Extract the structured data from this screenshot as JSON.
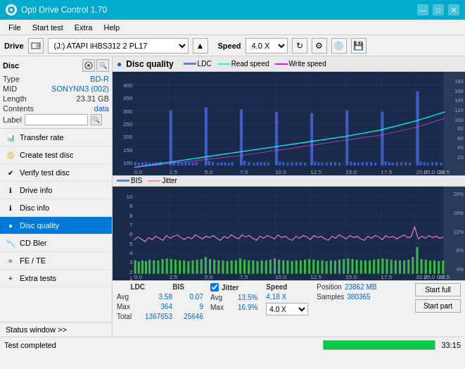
{
  "app": {
    "title": "Opti Drive Control 1.70",
    "min": "—",
    "max": "□",
    "close": "✕"
  },
  "menubar": {
    "items": [
      "File",
      "Start test",
      "Extra",
      "Help"
    ]
  },
  "toolbar": {
    "drive_label": "Drive",
    "drive_value": "(J:) ATAPI iHBS312  2 PL17",
    "speed_label": "Speed",
    "speed_value": "4.0 X"
  },
  "disc": {
    "title": "Disc",
    "type_label": "Type",
    "type_value": "BD-R",
    "mid_label": "MID",
    "mid_value": "SONYNN3 (002)",
    "length_label": "Length",
    "length_value": "23.31 GB",
    "contents_label": "Contents",
    "contents_value": "data",
    "label_label": "Label",
    "label_value": ""
  },
  "nav": {
    "items": [
      {
        "id": "transfer-rate",
        "label": "Transfer rate",
        "active": false
      },
      {
        "id": "create-test-disc",
        "label": "Create test disc",
        "active": false
      },
      {
        "id": "verify-test-disc",
        "label": "Verify test disc",
        "active": false
      },
      {
        "id": "drive-info",
        "label": "Drive info",
        "active": false
      },
      {
        "id": "disc-info",
        "label": "Disc info",
        "active": false
      },
      {
        "id": "disc-quality",
        "label": "Disc quality",
        "active": true
      },
      {
        "id": "cd-bler",
        "label": "CD Bler",
        "active": false
      },
      {
        "id": "fe-te",
        "label": "FE / TE",
        "active": false
      },
      {
        "id": "extra-tests",
        "label": "Extra tests",
        "active": false
      }
    ]
  },
  "status_window_btn": "Status window >>",
  "dq": {
    "title": "Disc quality",
    "icon": "●",
    "legend": {
      "ldc_label": "LDC",
      "ldc_color": "#4488ff",
      "read_label": "Read speed",
      "read_color": "#00ffff",
      "write_label": "Write speed",
      "write_color": "#ff00ff"
    },
    "legend2": {
      "bis_label": "BIS",
      "bis_color": "#4488ff",
      "jitter_label": "Jitter",
      "jitter_color": "#ff88cc"
    }
  },
  "stats": {
    "ldc_header": "LDC",
    "bis_header": "BIS",
    "jitter_header": "Jitter",
    "speed_header": "Speed",
    "avg_label": "Avg",
    "max_label": "Max",
    "total_label": "Total",
    "ldc_avg": "3.58",
    "ldc_max": "364",
    "ldc_total": "1367653",
    "bis_avg": "0.07",
    "bis_max": "9",
    "bis_total": "25646",
    "jitter_avg": "13.5%",
    "jitter_max": "16.9%",
    "jitter_checkbox": true,
    "speed_avg": "4.18 X",
    "speed_select": "4.0 X",
    "position_label": "Position",
    "position_value": "23862 MB",
    "samples_label": "Samples",
    "samples_value": "380365",
    "btn_start_full": "Start full",
    "btn_start_part": "Start part"
  },
  "app_status": {
    "text": "Test completed",
    "progress": 100,
    "time": "33:15"
  }
}
